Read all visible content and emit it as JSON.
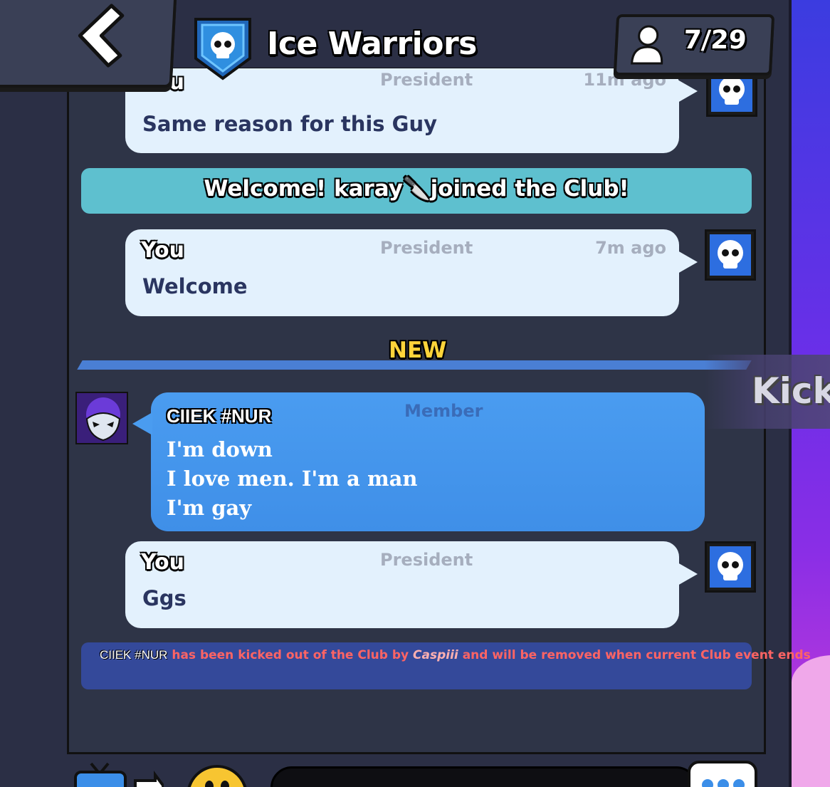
{
  "header": {
    "club_name": "Ice Warriors",
    "members_count": "7/29"
  },
  "messages": [
    {
      "sender": "You",
      "role": "President",
      "time": "11m ago",
      "text": "Same reason for this Guy"
    },
    {
      "system": "Welcome! karay🔪joined the Club!"
    },
    {
      "sender": "You",
      "role": "President",
      "time": "7m ago",
      "text": "Welcome"
    }
  ],
  "divider": {
    "label": "NEW"
  },
  "member_message": {
    "sender": "CIIEK #NUR",
    "role": "Member",
    "lines": [
      "I'm down",
      "I love men. I'm a man",
      "I'm gay"
    ]
  },
  "kick_action": {
    "label": "Kick"
  },
  "last_message": {
    "sender": "You",
    "role": "President",
    "text": "Ggs"
  },
  "kicked_notice": {
    "name": "CIIEK #NUR",
    "pre": "has been kicked out of the Club by",
    "by": "Caspiii",
    "post": "and will be removed when current Club event ends"
  },
  "colors": {
    "accent_blue": "#4a9cf0",
    "system_teal": "#5ec0cf",
    "new_label": "#ffd43a",
    "kicked_red": "#ff6464"
  },
  "icons": {
    "back": "chevron-left-icon",
    "club_badge": "skull-shield-icon",
    "members": "person-icon",
    "avatar_you": "skull-icon",
    "avatar_member": "mask-icon",
    "emoji": "emoji-icon",
    "send": "chat-dots-icon",
    "tv": "tv-icon"
  }
}
